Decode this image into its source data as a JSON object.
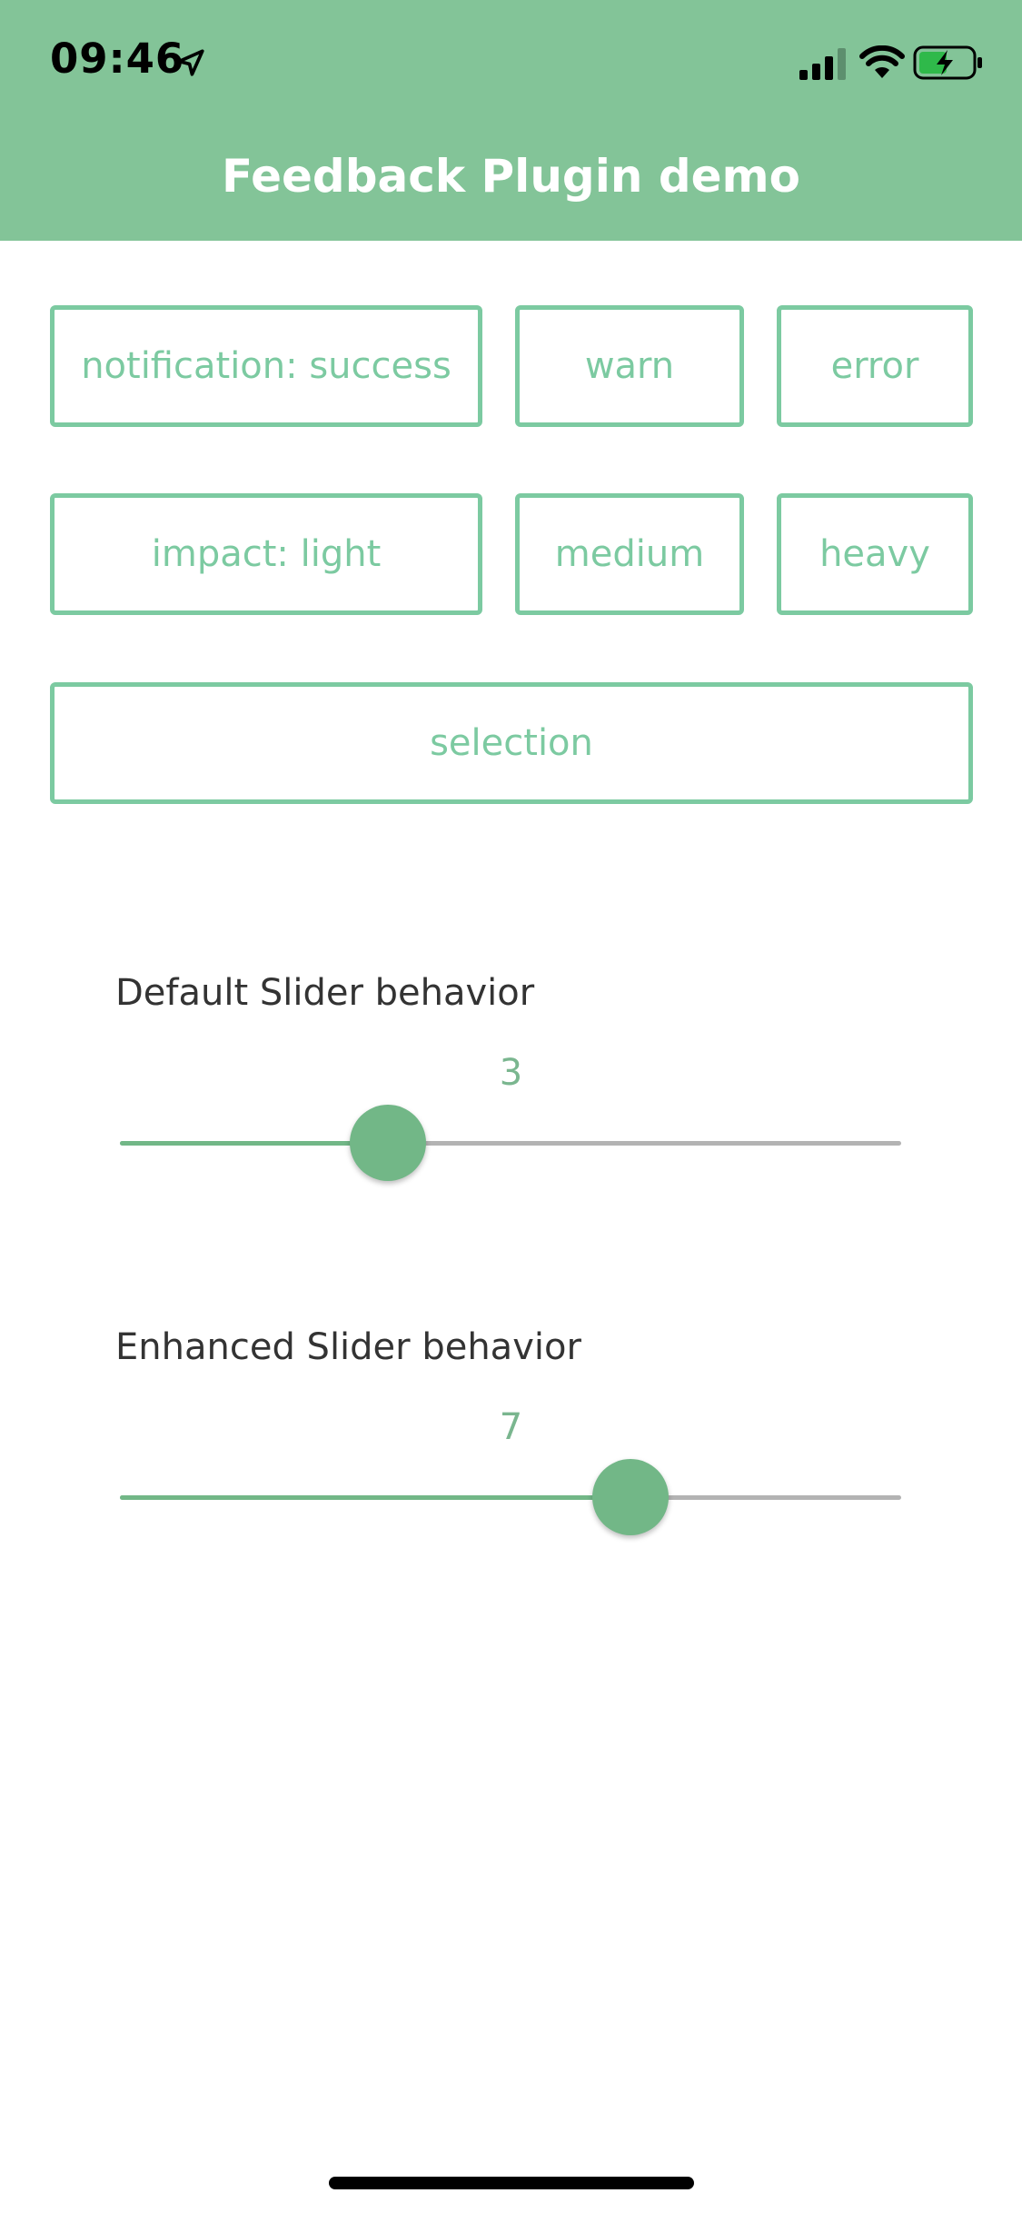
{
  "status_bar": {
    "time": "09:46"
  },
  "nav": {
    "title": "Feedback Plugin demo"
  },
  "buttons": {
    "notification_success": "notification: success",
    "warn": "warn",
    "error": "error",
    "impact_light": "impact: light",
    "medium": "medium",
    "heavy": "heavy",
    "selection": "selection"
  },
  "sliders": [
    {
      "label": "Default Slider behavior",
      "value": "3",
      "fraction": 0.343
    },
    {
      "label": "Enhanced Slider behavior",
      "value": "7",
      "fraction": 0.653
    }
  ],
  "colors": {
    "header": "#83c498",
    "accent": "#7ccaa1",
    "slider": "#72b787"
  }
}
